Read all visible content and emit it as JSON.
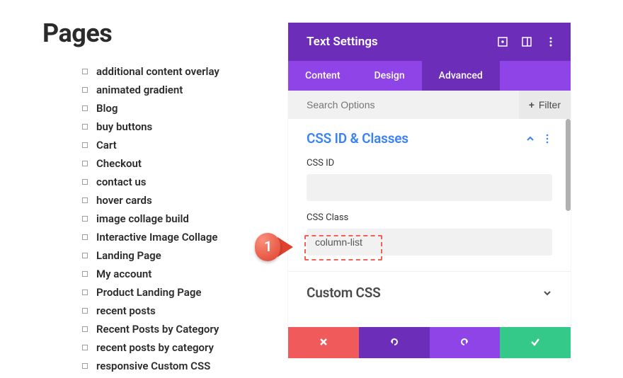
{
  "pages_heading": "Pages",
  "pages_list": [
    "additional content overlay",
    "animated gradient",
    "Blog",
    "buy buttons",
    "Cart",
    "Checkout",
    "contact us",
    "hover cards",
    "image collage build",
    "Interactive Image Collage",
    "Landing Page",
    "My account",
    "Product Landing Page",
    "recent posts",
    "Recent Posts by Category",
    "recent posts by category",
    "responsive Custom CSS"
  ],
  "panel": {
    "title": "Text Settings",
    "tabs": [
      "Content",
      "Design",
      "Advanced"
    ],
    "active_tab": "Advanced",
    "search_placeholder": "Search Options",
    "filter_label": "Filter",
    "section_open": {
      "title": "CSS ID & Classes",
      "fields": {
        "css_id_label": "CSS ID",
        "css_id_value": "",
        "css_class_label": "CSS Class",
        "css_class_value": "column-list"
      }
    },
    "section_closed": {
      "title": "Custom CSS"
    }
  },
  "callout": {
    "number": "1"
  }
}
